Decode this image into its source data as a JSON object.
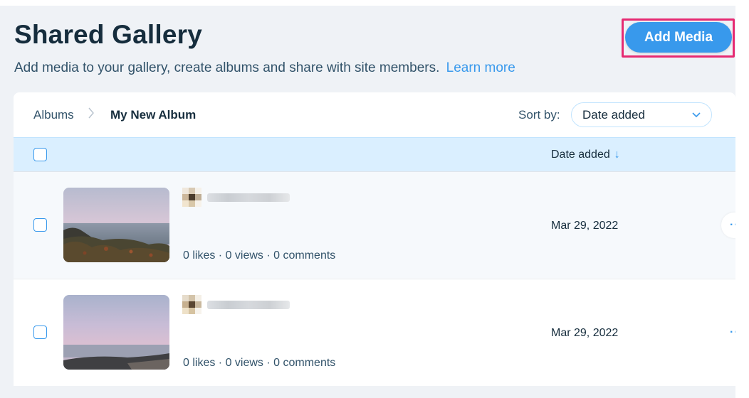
{
  "header": {
    "title": "Shared Gallery",
    "subtitle": "Add media to your gallery, create albums and share with site members.",
    "learn_more": "Learn more",
    "add_media_label": "Add Media"
  },
  "toolbar": {
    "breadcrumb_root": "Albums",
    "breadcrumb_current": "My New Album",
    "sort_label": "Sort by:",
    "sort_value": "Date added"
  },
  "table": {
    "date_column": "Date added",
    "rows": [
      {
        "stats": "0 likes · 0 views · 0 comments",
        "date": "Mar 29, 2022"
      },
      {
        "stats": "0 likes · 0 views · 0 comments",
        "date": "Mar 29, 2022"
      }
    ]
  },
  "colors": {
    "accent": "#3899ec",
    "highlight": "#e62a72",
    "header_row": "#daefff"
  },
  "icons": [
    "chevron-right-icon",
    "chevron-down-icon",
    "arrow-down-icon",
    "more-icon"
  ]
}
